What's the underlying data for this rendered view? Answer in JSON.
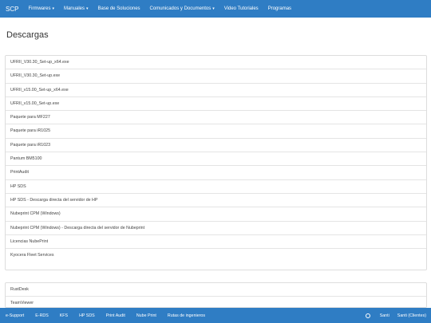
{
  "nav": {
    "brand": "SCP",
    "items": [
      {
        "label": "Firmwares",
        "dropdown": true
      },
      {
        "label": "Manuales",
        "dropdown": true
      },
      {
        "label": "Base de Soluciones",
        "dropdown": false
      },
      {
        "label": "Comunicados y Documentos",
        "dropdown": true
      },
      {
        "label": "Video Tutoriales",
        "dropdown": false
      },
      {
        "label": "Programas",
        "dropdown": false
      }
    ],
    "caret": "▾"
  },
  "page": {
    "title": "Descargas"
  },
  "downloads": [
    "UFRII_V30.30_Set-up_x64.exe",
    "UFRII_V30.30_Set-up.exe",
    "UFRII_v15.00_Set-up_x64.exe",
    "UFRII_v15.00_Set-up.exe",
    "Paquete para MF227",
    "Paquete para iR1025",
    "Paquete para iR1023",
    "Pantum BM5100",
    "PrintAudit",
    "HP SDS",
    "HP SDS - Descarga directa del servidor de HP",
    "Nubeprint CPM (Windows)",
    "Nubeprint CPM (Windows) - Descarga directa del servidor de Nubeprint",
    "Licencias NubePrint",
    "Kyocera Fleet Services"
  ],
  "tools": [
    "RustDesk",
    "TeamViewer"
  ],
  "footer": {
    "left": [
      "e-Support",
      "E-RDS",
      "KFS",
      "HP SDS",
      "Print Audit",
      "Nube Print",
      "Rutas de ingenieros"
    ],
    "gear_icon": "gear-icon",
    "right": [
      "Santi",
      "Santi (Clientes)"
    ]
  },
  "colors": {
    "navbar": "#2f7dc4",
    "footer": "#2f7dc4"
  }
}
